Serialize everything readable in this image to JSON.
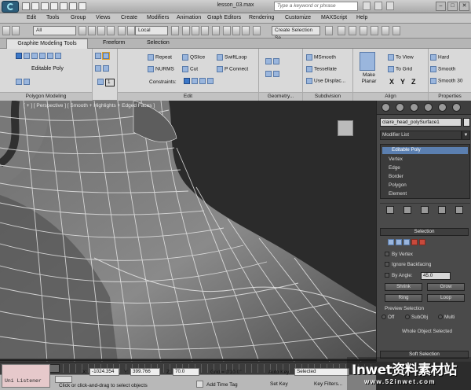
{
  "window": {
    "title": "lesson_03.max",
    "help_placeholder": "Type a keyword or phrase"
  },
  "menu": [
    "Edit",
    "Tools",
    "Group",
    "Views",
    "Create",
    "Modifiers",
    "Animation",
    "Graph Editors",
    "Rendering",
    "Customize",
    "MAXScript",
    "Help"
  ],
  "toolbar": {
    "filter": "All",
    "coord": "Local",
    "selection_set": "Create Selection Se"
  },
  "ribbon_tabs": [
    "Graphite Modeling Tools",
    "Freeform",
    "Selection"
  ],
  "ribbon": {
    "polygon_modeling": {
      "label": "Editable Poly",
      "footer": "Polygon Modeling",
      "spinner": "1"
    },
    "modify": {
      "repeat": "Repeat",
      "nurms": "NURMS",
      "qslice": "QSlice",
      "cut": "Cut",
      "swiftloop": "SwiftLoop",
      "pconnect": "P Connect",
      "constraints": "Constraints:",
      "footer": "Edit"
    },
    "geometry": {
      "footer": "Geometry..."
    },
    "subdivision": {
      "msmooth": "MSmooth",
      "tessellate": "Tessellate",
      "use_displace": "Use Displac...",
      "footer": "Subdivision"
    },
    "align": {
      "make_planar": "Make Planar",
      "to_view": "To View",
      "to_grid": "To Grid",
      "x": "X",
      "y": "Y",
      "z": "Z",
      "footer": "Align"
    },
    "properties": {
      "hard": "Hard",
      "smooth": "Smooth",
      "smooth30": "Smooth 30",
      "footer": "Properties"
    }
  },
  "viewport": {
    "label": "[ + ] [ Perspective ] [ Smooth + Highlights + Edged Faces ]"
  },
  "command_panel": {
    "object_name": "claire_head_polySurface1",
    "modifier_list": "Modifier List",
    "stack": {
      "top": "Editable Poly",
      "subs": [
        "Vertex",
        "Edge",
        "Border",
        "Polygon",
        "Element"
      ]
    },
    "selection": {
      "title": "Selection",
      "by_vertex": "By Vertex",
      "ignore_backfacing": "Ignore Backfacing",
      "by_angle": "By Angle:",
      "angle_value": "45.0",
      "shrink": "Shrink",
      "grow": "Grow",
      "ring": "Ring",
      "loop": "Loop",
      "preview_title": "Preview Selection",
      "preview_opts": [
        "Off",
        "SubObj",
        "Multi"
      ],
      "whole_object": "Whole Object Selected"
    },
    "soft_selection": "Soft Selection"
  },
  "timeline": {
    "frame": "0 / 100"
  },
  "status": {
    "listener": "Uni Listener",
    "prompt": "Click or click-and-drag to select objects",
    "x_label": "X:",
    "x": "-1024.354",
    "y_label": "Y:",
    "y": "399.766",
    "z_label": "Z:",
    "z": "70.0",
    "grid": "Grid = 0'10.0\"",
    "add_time_tag": "Add Time Tag",
    "auto_key": "Auto Key",
    "selected": "Selected",
    "set_key": "Set Key",
    "key_filters": "Key Filters..."
  },
  "watermark": {
    "main": "Inwet资料素材站",
    "sub": "www.52inwet.com"
  }
}
